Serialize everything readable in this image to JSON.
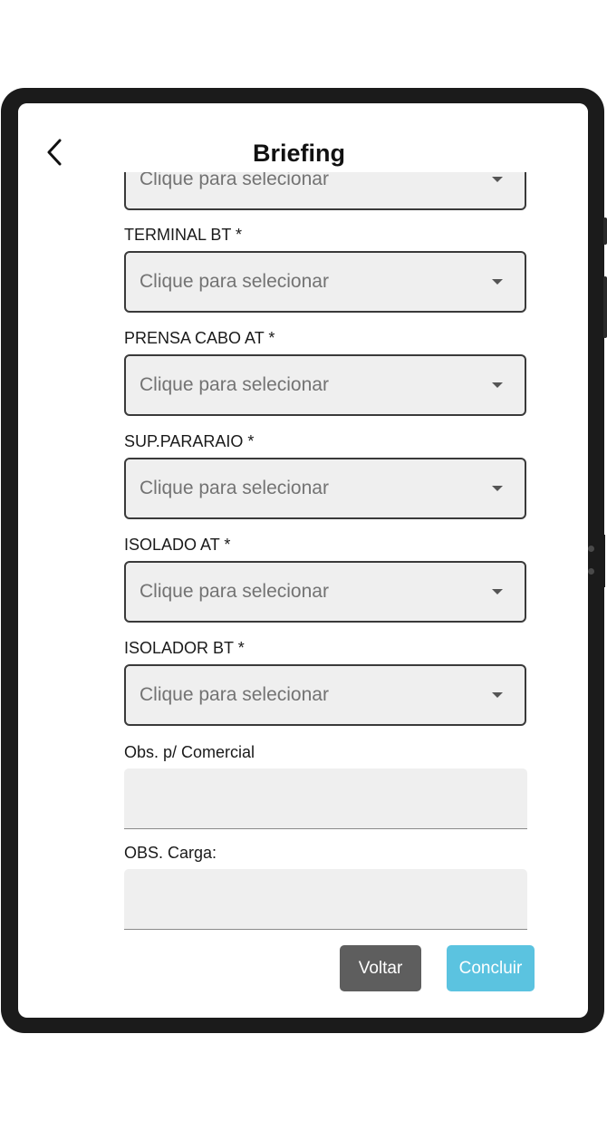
{
  "header": {
    "title": "Briefing",
    "back_icon": "chevron-left-icon"
  },
  "fields": {
    "top_partial": {
      "placeholder": "Clique para selecionar"
    },
    "terminal_bt": {
      "label": "TERMINAL BT *",
      "placeholder": "Clique para selecionar"
    },
    "prensa_cabo_at": {
      "label": "PRENSA CABO AT *",
      "placeholder": "Clique para selecionar"
    },
    "sup_pararaio": {
      "label": "SUP.PARARAIO *",
      "placeholder": "Clique para selecionar"
    },
    "isolado_at": {
      "label": "ISOLADO AT *",
      "placeholder": "Clique para selecionar"
    },
    "isolador_bt": {
      "label": "ISOLADOR BT *",
      "placeholder": "Clique para selecionar"
    },
    "obs_comercial": {
      "label": "Obs. p/ Comercial",
      "value": ""
    },
    "obs_carga": {
      "label": "OBS. Carga:",
      "value": ""
    }
  },
  "actions": {
    "back_label": "Voltar",
    "finish_label": "Concluir"
  },
  "colors": {
    "finish_button": "#5bc3e0",
    "back_button": "#5e5e5e",
    "field_background": "#efefef"
  }
}
